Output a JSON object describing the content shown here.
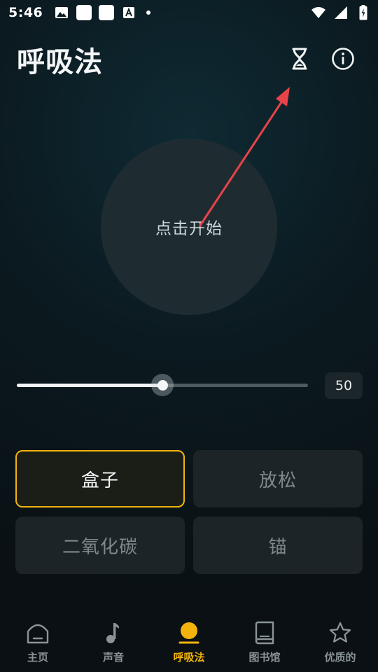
{
  "status_bar": {
    "time": "5:46",
    "left_icons": [
      "image-icon",
      "app-square-icon",
      "app-square-icon",
      "font-a-icon",
      "dot-icon"
    ],
    "right_icons": [
      "wifi-icon",
      "signal-icon",
      "battery-charging-icon"
    ]
  },
  "header": {
    "title": "呼吸法",
    "timer_icon": "hourglass-icon",
    "info_icon": "info-icon"
  },
  "start_button": {
    "label": "点击开始"
  },
  "slider": {
    "value": "50",
    "fill_fraction": 0.5
  },
  "modes": [
    {
      "label": "盒子",
      "selected": true
    },
    {
      "label": "放松",
      "selected": false
    },
    {
      "label": "二氧化碳",
      "selected": false
    },
    {
      "label": "锚",
      "selected": false
    }
  ],
  "bottom_nav": [
    {
      "label": "主页",
      "icon": "home-icon",
      "active": false
    },
    {
      "label": "声音",
      "icon": "music-note-icon",
      "active": false
    },
    {
      "label": "呼吸法",
      "icon": "breathing-icon",
      "active": true
    },
    {
      "label": "图书馆",
      "icon": "book-icon",
      "active": false
    },
    {
      "label": "优质的",
      "icon": "star-icon",
      "active": false
    }
  ],
  "colors": {
    "accent": "#f2b40c",
    "annotation_arrow": "#e8434a",
    "background": "#0b1a20"
  }
}
